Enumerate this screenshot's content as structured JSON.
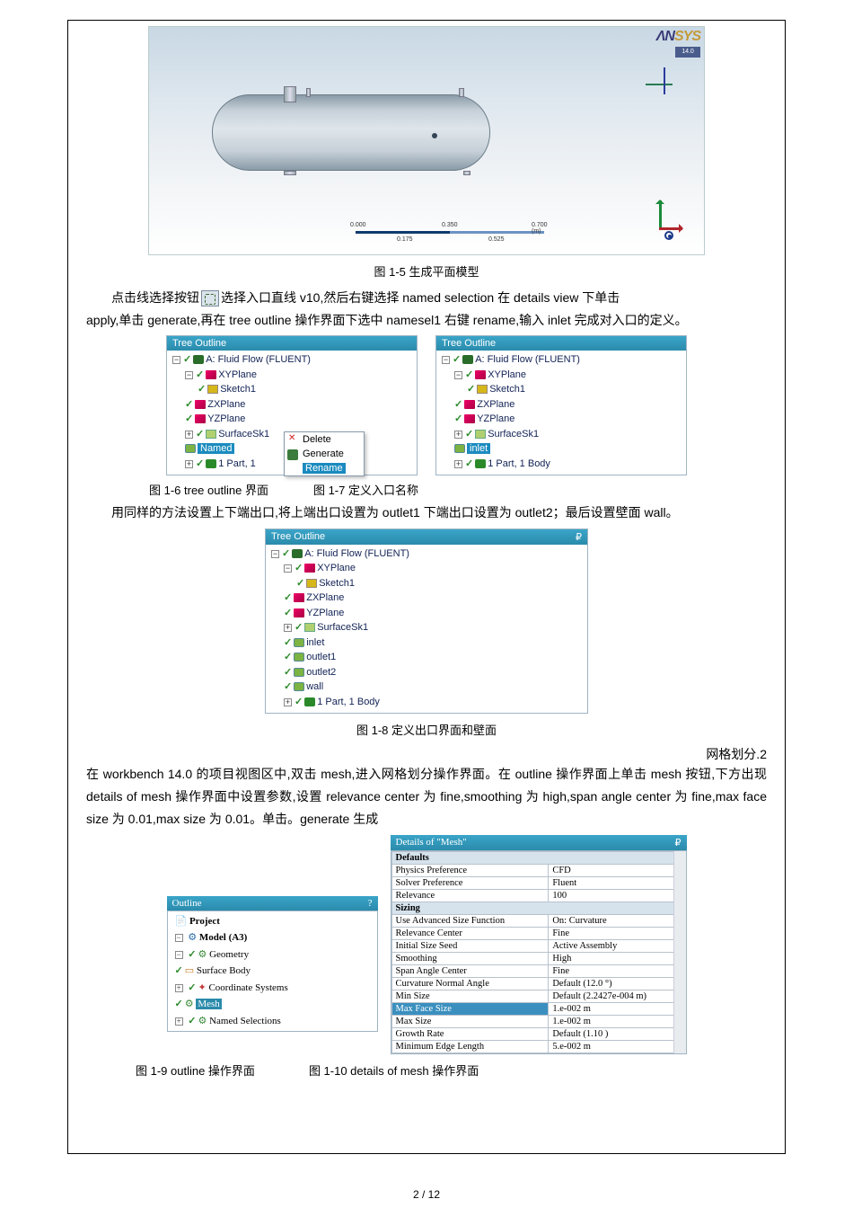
{
  "viewport": {
    "logo_prefix": "ΛN",
    "logo_y": "SYS",
    "badge": "14.0",
    "scale": {
      "t0": "0.000",
      "t1": "0.350",
      "t2": "0.700 (m)",
      "m1": "0.175",
      "m2": "0.525"
    }
  },
  "cap1": "图 1-5 生成平面模型",
  "para1_a": "点击线选择按钮",
  "para1_b": "选择入口直线 v10,然后右键选择 named selection 在 details view 下单击",
  "para2": "apply,单击 generate,再在 tree outline 操作界面下选中 namesel1 右键 rename,输入 inlet 完成对入口的定义。",
  "treeL": {
    "hdr": "Tree Outline",
    "root": "A: Fluid Flow (FLUENT)",
    "xy": "XYPlane",
    "sk": "Sketch1",
    "zx": "ZXPlane",
    "yz": "YZPlane",
    "surf": "SurfaceSk1",
    "named": "Named",
    "part": "1 Part, 1",
    "ctx_del": "Delete",
    "ctx_gen": "Generate",
    "ctx_ren": "Rename"
  },
  "treeR": {
    "hdr": "Tree Outline",
    "root": "A: Fluid Flow (FLUENT)",
    "xy": "XYPlane",
    "sk": "Sketch1",
    "zx": "ZXPlane",
    "yz": "YZPlane",
    "surf": "SurfaceSk1",
    "inlet": "inlet",
    "part": "1 Part, 1 Body"
  },
  "cap_row": {
    "l": "图 1-6 tree outline 界面",
    "r": "图 1-7 定义入口名称"
  },
  "para3": "用同样的方法设置上下端出口,将上端出口设置为 outlet1 下端出口设置为 outlet2；最后设置壁面 wall。",
  "treeW": {
    "hdr": "Tree Outline",
    "root": "A: Fluid Flow (FLUENT)",
    "xy": "XYPlane",
    "sk": "Sketch1",
    "zx": "ZXPlane",
    "yz": "YZPlane",
    "surf": "SurfaceSk1",
    "inlet": "inlet",
    "o1": "outlet1",
    "o2": "outlet2",
    "wall": "wall",
    "part": "1 Part, 1 Body"
  },
  "cap2": "图 1-8 定义出口界面和壁面",
  "sec": "网格划分.2",
  "para4": "在 workbench 14.0 的项目视图区中,双击 mesh,进入网格划分操作界面。在 outline 操作界面上单击 mesh 按钮,下方出现 details of mesh 操作界面中设置参数,设置 relevance center 为 fine,smoothing 为 high,span angle center 为 fine,max face size 为 0.01,max size 为 0.01。单击。generate 生成",
  "outline": {
    "hdr": "Outline",
    "proj": "Project",
    "model": "Model (A3)",
    "geom": "Geometry",
    "sb": "Surface Body",
    "cs": "Coordinate Systems",
    "mesh": "Mesh",
    "ns": "Named Selections"
  },
  "mesh": {
    "hdr": "Details of \"Mesh\"",
    "grp1": "Defaults",
    "rows1": [
      [
        "Physics Preference",
        "CFD"
      ],
      [
        "Solver Preference",
        "Fluent"
      ],
      [
        "    Relevance",
        "100"
      ]
    ],
    "grp2": "Sizing",
    "rows2": [
      [
        "Use Advanced Size Function",
        "On: Curvature"
      ],
      [
        "Relevance Center",
        "Fine"
      ],
      [
        "Initial Size Seed",
        "Active Assembly"
      ],
      [
        "Smoothing",
        "High"
      ],
      [
        "Span Angle Center",
        "Fine"
      ],
      [
        "    Curvature Normal Angle",
        "Default (12.0 °)"
      ],
      [
        "    Min Size",
        "Default (2.2427e-004 m)"
      ]
    ],
    "hl": [
      "    Max Face Size",
      "1.e-002 m"
    ],
    "rows3": [
      [
        "    Max Size",
        "1.e-002 m"
      ],
      [
        "    Growth Rate",
        "Default (1.10 )"
      ],
      [
        "Minimum Edge Length",
        "5.e-002 m"
      ]
    ]
  },
  "cap_row2": {
    "l": "图 1-9 outline 操作界面",
    "r": "图 1-10 details of mesh 操作界面"
  },
  "page": "2 / 12"
}
